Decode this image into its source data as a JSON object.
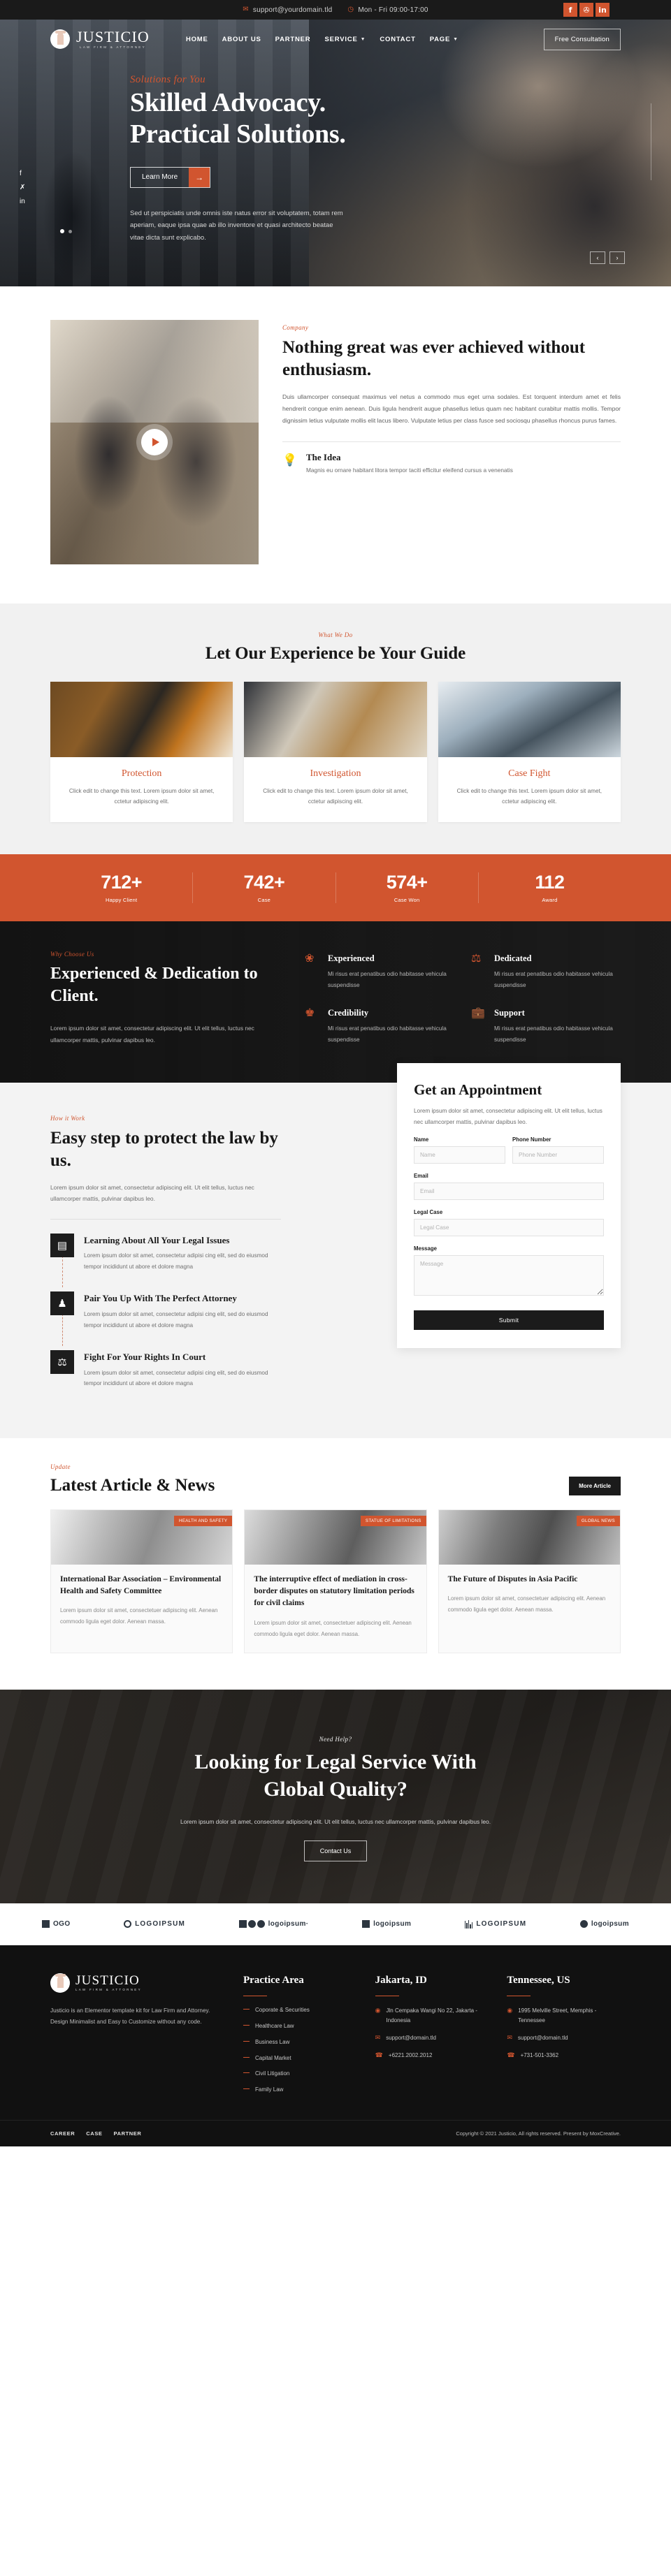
{
  "topbar": {
    "email": "support@yourdomain.tld",
    "hours": "Mon - Fri 09:00-17:00",
    "email_icon": "envelope-icon",
    "clock_icon": "clock-icon",
    "social": [
      {
        "name": "facebook",
        "glyph": "f"
      },
      {
        "name": "twitter",
        "glyph": "✇"
      },
      {
        "name": "linkedin",
        "glyph": "in"
      }
    ]
  },
  "brand": {
    "name": "JUSTICIO",
    "tagline": "LAW FIRM & ATTORNEY"
  },
  "nav": {
    "items": [
      {
        "label": "HOME",
        "caret": false
      },
      {
        "label": "ABOUT US",
        "caret": false
      },
      {
        "label": "PARTNER",
        "caret": false
      },
      {
        "label": "SERVICE",
        "caret": true
      },
      {
        "label": "CONTACT",
        "caret": false
      },
      {
        "label": "PAGE",
        "caret": true
      }
    ],
    "cta": "Free Consultation"
  },
  "hero": {
    "eyebrow": "Solutions for You",
    "title_line1": "Skilled Advocacy.",
    "title_line2": "Practical Solutions.",
    "button": "Learn More",
    "button_arrow": "→",
    "paragraph": "Sed ut perspiciatis unde omnis iste natus error sit voluptatem, totam rem aperiam, eaque ipsa quae ab illo inventore et quasi architecto beatae vitae dicta sunt explicabo.",
    "prev_arrow": "‹",
    "next_arrow": "›"
  },
  "about": {
    "eyebrow": "Company",
    "title": "Nothing great was ever achieved without enthusiasm.",
    "paragraph": "Duis ullamcorper consequat maximus vel netus a commodo mus eget urna sodales. Est torquent interdum amet et felis hendrerit congue enim aenean. Duis ligula hendrerit augue phasellus letius quam nec habitant curabitur mattis mollis. Tempor dignissim letius vulputate mollis elit lacus libero. Vulputate letius per class fusce sed sociosqu phasellus rhoncus purus fames.",
    "idea_icon": "lightbulb-icon",
    "idea_title": "The Idea",
    "idea_text": "Magnis eu ornare habitant litora tempor taciti efficitur eleifend cursus a venenatis"
  },
  "services": {
    "eyebrow": "What We Do",
    "title": "Let Our Experience be Your Guide",
    "cards": [
      {
        "title": "Protection",
        "text": "Click edit to change this text. Lorem ipsum dolor sit amet, cctetur adipiscing elit."
      },
      {
        "title": "Investigation",
        "text": "Click edit to change this text. Lorem ipsum dolor sit amet, cctetur adipiscing elit."
      },
      {
        "title": "Case Fight",
        "text": "Click edit to change this text. Lorem ipsum dolor sit amet, cctetur adipiscing elit."
      }
    ]
  },
  "stats": {
    "accent": "#d1552f",
    "items": [
      {
        "value": "712+",
        "label": "Happy Client"
      },
      {
        "value": "742+",
        "label": "Case"
      },
      {
        "value": "574+",
        "label": "Case Won"
      },
      {
        "value": "112",
        "label": "Award"
      }
    ]
  },
  "why": {
    "eyebrow": "Why Choose Us",
    "title": "Experienced & Dedication to Client.",
    "paragraph": "Lorem ipsum dolor sit amet, consectetur adipiscing elit. Ut elit tellus, luctus nec ullamcorper mattis, pulvinar dapibus leo.",
    "features": [
      {
        "icon": "wreath-star-icon",
        "glyph": "❀",
        "title": "Experienced",
        "text": "Mi risus erat penatibus odio habitasse vehicula suspendisse"
      },
      {
        "icon": "scales-icon",
        "glyph": "⚖",
        "title": "Dedicated",
        "text": "Mi risus erat penatibus odio habitasse vehicula suspendisse"
      },
      {
        "icon": "podium-icon",
        "glyph": "♟",
        "title": "Credibility",
        "text": "Mi risus erat penatibus odio habitasse vehicula suspendisse"
      },
      {
        "icon": "briefcase-icon",
        "glyph": "ὋC",
        "title": "Support",
        "text": "Mi risus erat penatibus odio habitasse vehicula suspendisse"
      }
    ]
  },
  "steps": {
    "eyebrow": "How it Work",
    "title": "Easy step to protect the law by us.",
    "paragraph": "Lorem ipsum dolor sit amet, consectetur adipiscing elit. Ut elit tellus, luctus nec ullamcorper mattis, pulvinar dapibus leo.",
    "items": [
      {
        "icon": "clipboard-icon",
        "glyph": "☰",
        "title": "Learning About All Your Legal Issues",
        "text": "Lorem ipsum dolor sit amet, consectetur adipisi cing elit, sed do eiusmod tempor incididunt ut abore et dolore magna"
      },
      {
        "icon": "attorney-icon",
        "glyph": "♟",
        "title": "Pair You Up With The Perfect Attorney",
        "text": "Lorem ipsum dolor sit amet, consectetur adipisi cing elit, sed do eiusmod tempor incididunt ut abore et dolore magna"
      },
      {
        "icon": "scales-icon",
        "glyph": "⚖",
        "title": "Fight For Your Rights In Court",
        "text": "Lorem ipsum dolor sit amet, consectetur adipisi cing elit, sed do eiusmod tempor incididunt ut abore et dolore magna"
      }
    ]
  },
  "form": {
    "title": "Get an Appointment",
    "description": "Lorem ipsum dolor sit amet, consectetur adipiscing elit. Ut elit tellus, luctus nec ullamcorper mattis, pulvinar dapibus leo.",
    "fields": {
      "name_label": "Name",
      "name_placeholder": "Name",
      "phone_label": "Phone Number",
      "phone_placeholder": "Phone Number",
      "email_label": "Email",
      "email_placeholder": "Email",
      "case_label": "Legal Case",
      "case_placeholder": "Legal Case",
      "message_label": "Message",
      "message_placeholder": "Message"
    },
    "submit": "Submit"
  },
  "news": {
    "eyebrow": "Update",
    "title": "Latest Article & News",
    "more_button": "More Article",
    "articles": [
      {
        "tag": "HEALTH AND SAFETY",
        "title": "International Bar Association – Environmental Health and Safety Committee",
        "text": "Lorem ipsum dolor sit amet, consectetuer adipiscing elit. Aenean commodo ligula eget dolor. Aenean massa."
      },
      {
        "tag": "STATUE OF LIMITATIONS",
        "title": "The interruptive effect of mediation in cross-border disputes on statutory limitation periods for civil claims",
        "text": "Lorem ipsum dolor sit amet, consectetuer adipiscing elit. Aenean commodo ligula eget dolor. Aenean massa."
      },
      {
        "tag": "GLOBAL NEWS",
        "title": "The Future of Disputes in Asia Pacific",
        "text": "Lorem ipsum dolor sit amet, consectetuer adipiscing elit. Aenean commodo ligula eget dolor. Aenean massa."
      }
    ]
  },
  "cta": {
    "eyebrow": "Need Help?",
    "title_line1": "Looking for Legal Service With",
    "title_line2": "Global Quality?",
    "paragraph": "Lorem ipsum dolor sit amet, consectetur adipiscing elit. Ut elit tellus, luctus nec ullamcorper mattis, pulvinar dapibus leo.",
    "button": "Contact Us"
  },
  "logos": [
    {
      "name": "logo-mark-logo",
      "text": "OGO"
    },
    {
      "name": "logoipsum-wheat",
      "text": "LOGOIPSUM"
    },
    {
      "name": "logoipsum-shapes",
      "text": "logoipsum·"
    },
    {
      "name": "logoipsum-page",
      "text": "logoipsum"
    },
    {
      "name": "logoipsum-bars",
      "text": "LOGOIPSUM"
    },
    {
      "name": "logoipsum-wave",
      "text": "logoipsum"
    }
  ],
  "footer": {
    "about": "Justicio is an Elementor template kit for Law Firm and Attorney. Design Minimalist and Easy to Customize without any code.",
    "practice": {
      "heading": "Practice Area",
      "links": [
        "Coporate & Securities",
        "Healthcare Law",
        "Business Law",
        "Capital Market",
        "Civil Litigation",
        "Family Law"
      ]
    },
    "jakarta": {
      "heading": "Jakarta, ID",
      "contacts": [
        {
          "icon": "map-pin-icon",
          "glyph": "◉",
          "text": "Jln Cempaka Wangi No 22, Jakarta - Indonesia"
        },
        {
          "icon": "envelope-icon",
          "glyph": "✉",
          "text": "support@domain.tld"
        },
        {
          "icon": "phone-icon",
          "glyph": "☎",
          "text": "+6221.2002.2012"
        }
      ]
    },
    "tennessee": {
      "heading": "Tennessee, US",
      "contacts": [
        {
          "icon": "map-pin-icon",
          "glyph": "◉",
          "text": "1995 Melville Street, Memphis - Tennessee"
        },
        {
          "icon": "envelope-icon",
          "glyph": "✉",
          "text": "support@domain.tld"
        },
        {
          "icon": "phone-icon",
          "glyph": "☎",
          "text": "+731-501-3362"
        }
      ]
    },
    "bottom_links": [
      "CAREER",
      "CASE",
      "PARTNER"
    ],
    "copyright": "Copyright © 2021 Justicio, All rights reserved. Present by MoxCreative."
  }
}
